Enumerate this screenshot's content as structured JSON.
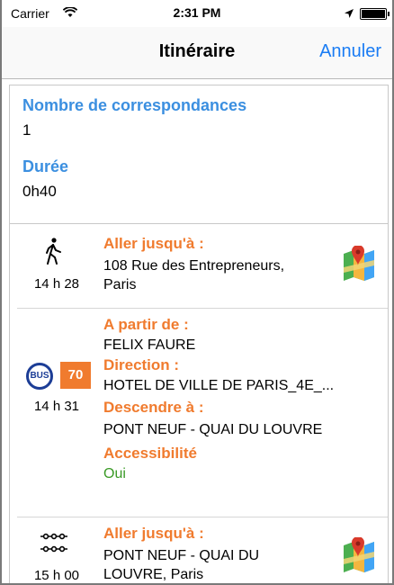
{
  "status_bar": {
    "carrier": "Carrier",
    "time": "2:31 PM"
  },
  "nav": {
    "title": "Itinéraire",
    "cancel_label": "Annuler"
  },
  "summary": {
    "transfers_label": "Nombre de correspondances",
    "transfers_value": "1",
    "duration_label": "Durée",
    "duration_value": "0h40"
  },
  "steps": [
    {
      "icon": "walk-icon",
      "time": "14 h 28",
      "title": "Aller jusqu'à :",
      "address_line1": "108 Rue des Entrepreneurs,",
      "address_line2": "Paris",
      "map_icon": "map-icon"
    },
    {
      "icon": "bus-icon",
      "icon_text": "BUS",
      "line": "70",
      "time": "14 h 31",
      "from_label": "A partir de :",
      "from_value": "FELIX FAURE",
      "direction_label": "Direction :",
      "direction_value": "HOTEL DE VILLE DE PARIS_4E_...",
      "alight_label": "Descendre à :",
      "alight_value": "PONT NEUF - QUAI DU LOUVRE",
      "accessibility_label": "Accessibilité",
      "accessibility_value": "Oui"
    },
    {
      "icon": "transfer-walk-icon",
      "time": "15 h 00",
      "title": "Aller jusqu'à :",
      "address_line1": "PONT NEUF - QUAI DU",
      "address_line2": "LOUVRE, Paris",
      "map_icon": "map-icon"
    }
  ],
  "colors": {
    "accent_blue": "#1a7cf4",
    "label_blue": "#3b8fe0",
    "label_orange": "#f07b2e",
    "value_green": "#3a9a26",
    "bus_blue": "#1c3d96"
  }
}
